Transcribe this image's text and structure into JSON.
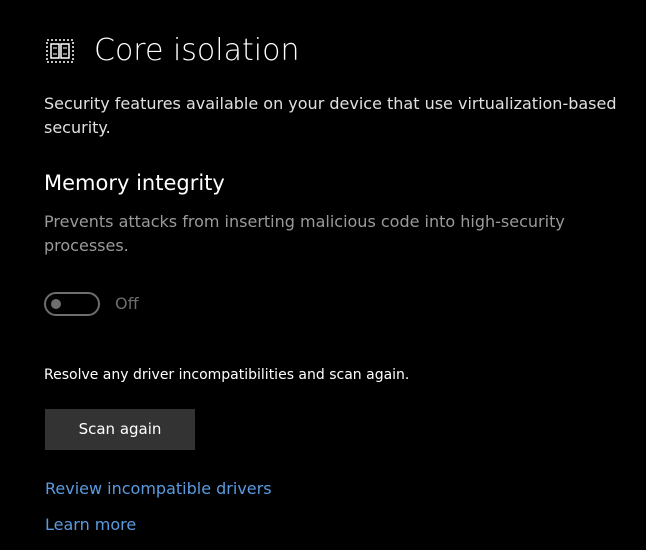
{
  "header": {
    "icon": "core-isolation-chip-icon",
    "title": "Core isolation"
  },
  "description": "Security features available on your device that use virtualization-based security.",
  "memory_integrity": {
    "title": "Memory integrity",
    "description": "Prevents attacks from inserting malicious code into high-security processes.",
    "toggle_state": "Off"
  },
  "resolve_text": "Resolve any driver incompatibilities and scan again.",
  "scan_button_label": "Scan again",
  "links": {
    "review": "Review incompatible drivers",
    "learn_more": "Learn more"
  },
  "colors": {
    "background": "#000000",
    "link": "#5b9be0",
    "toggle_disabled": "#6e6e6e",
    "button_bg": "#333333"
  }
}
